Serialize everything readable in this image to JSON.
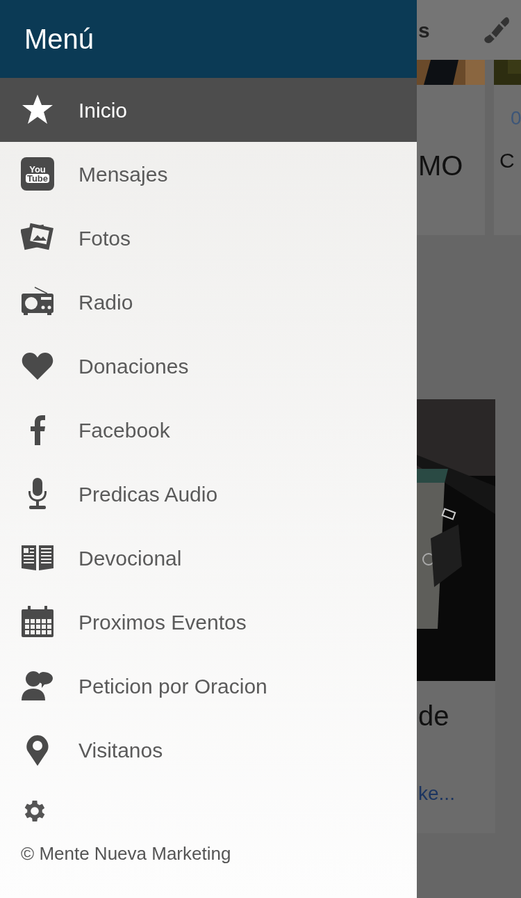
{
  "drawer": {
    "title": "Menú",
    "items": [
      {
        "label": "Inicio",
        "kind": "star",
        "selected": true
      },
      {
        "label": "Mensajes",
        "kind": "video",
        "logo_text": [
          "You",
          "Tube"
        ],
        "selected": false
      },
      {
        "label": "Fotos",
        "kind": "photos",
        "selected": false
      },
      {
        "label": "Radio",
        "kind": "radio",
        "selected": false
      },
      {
        "label": "Donaciones",
        "kind": "heart",
        "selected": false
      },
      {
        "label": "Facebook",
        "kind": "facebook",
        "selected": false
      },
      {
        "label": "Predicas Audio",
        "kind": "mic",
        "selected": false
      },
      {
        "label": "Devocional",
        "kind": "book",
        "selected": false
      },
      {
        "label": "Proximos Eventos",
        "kind": "calendar",
        "selected": false
      },
      {
        "label": "Peticion por Oracion",
        "kind": "people",
        "selected": false
      },
      {
        "label": "Visitanos",
        "kind": "pin",
        "selected": false
      }
    ],
    "footer": "© Mente Nueva Marketing"
  },
  "background": {
    "header_text": "s",
    "card_1_text": "MO",
    "card_2_date": "0",
    "card_2_text": "C",
    "post_title": "de",
    "post_excerpt": "ke..."
  }
}
